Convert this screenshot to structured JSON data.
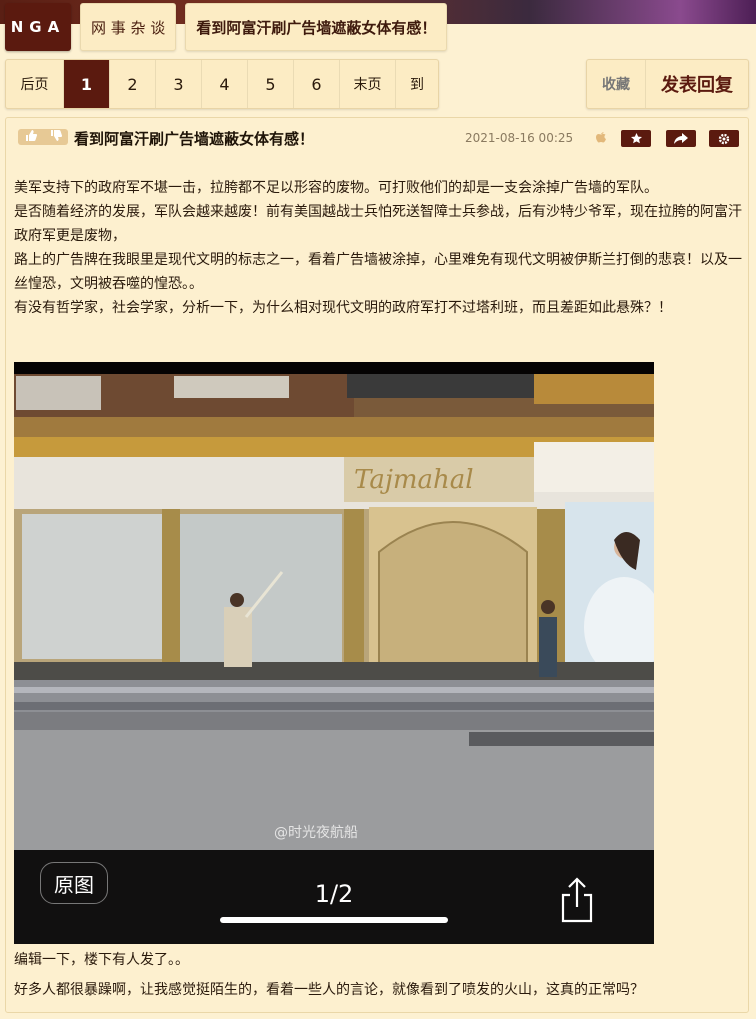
{
  "breadcrumb": {
    "logo": "NGA",
    "forum": "网 事 杂 谈",
    "thread": "看到阿富汗刷广告墙遮蔽女体有感！"
  },
  "pager": {
    "prev": "后页",
    "pages": [
      "1",
      "2",
      "3",
      "4",
      "5",
      "6"
    ],
    "current_page": "1",
    "last": "末页",
    "goto": "到"
  },
  "actions": {
    "favorite": "收藏",
    "reply": "发表回复"
  },
  "post": {
    "title": "看到阿富汗刷广告墙遮蔽女体有感！",
    "time": "2021-08-16 00:25",
    "paragraphs": [
      "美军支持下的政府军不堪一击，拉胯都不足以形容的废物。可打败他们的却是一支会涂掉广告墙的军队。",
      "是否随着经济的发展，军队会越来越废！前有美国越战士兵怕死送智障士兵参战，后有沙特少爷军，现在拉胯的阿富汗政府军更是废物，",
      "路上的广告牌在我眼里是现代文明的标志之一，看着广告墙被涂掉，心里难免有现代文明被伊斯兰打倒的悲哀！以及一丝惶恐，文明被吞噬的惶恐。。",
      "有没有哲学家，社会学家，分析一下，为什么相对现代文明的政府军打不过塔利班，而且差距如此悬殊？！"
    ],
    "after": [
      "编辑一下，楼下有人发了。。",
      "好多人都很暴躁啊，让我感觉挺陌生的，看着一些人的言论，就像看到了喷发的火山，这真的正常吗？"
    ]
  },
  "photo": {
    "shop_sign": "Tajmahal",
    "watermark": "@时光夜航船",
    "original_button": "原图",
    "page_counter": "1/2"
  },
  "colors": {
    "accent": "#5b1a0f",
    "background": "#fdf1d2",
    "panel": "#fcecc4"
  }
}
